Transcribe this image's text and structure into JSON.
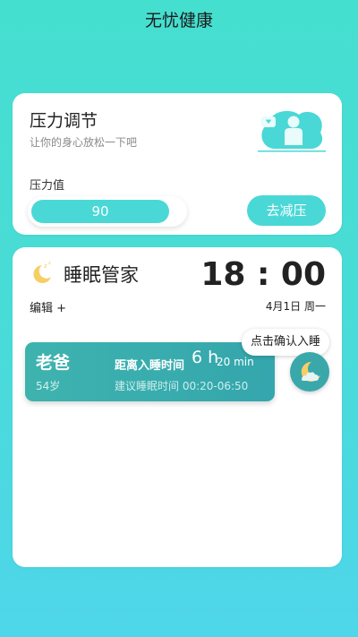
{
  "app": {
    "title": "无忧健康"
  },
  "stress_card": {
    "title": "压力调节",
    "subtitle": "让你的身心放松一下吧",
    "value_label": "压力值",
    "value": "90",
    "value_fraction": 0.9,
    "action_label": "去减压"
  },
  "sleep_card": {
    "title": "睡眠管家",
    "time": "18 : 00",
    "date": "4月1日 周一",
    "edit_label": "编辑 +",
    "members": [
      {
        "name": "老爸",
        "age": "54岁",
        "countdown_label": "距离入睡时间",
        "countdown_hours": "6 h",
        "countdown_minutes": "20 min",
        "suggest_label": "建议睡眠时间",
        "suggest_time": "00:20-06:50",
        "suggest_text": "建议睡眠时间 00:20-06:50"
      }
    ],
    "sleep_action_tooltip": "点击确认入睡"
  },
  "colors": {
    "accent": "#49d8d6",
    "card_teal": "#3eb3ae",
    "moon": "#f5cf63"
  }
}
